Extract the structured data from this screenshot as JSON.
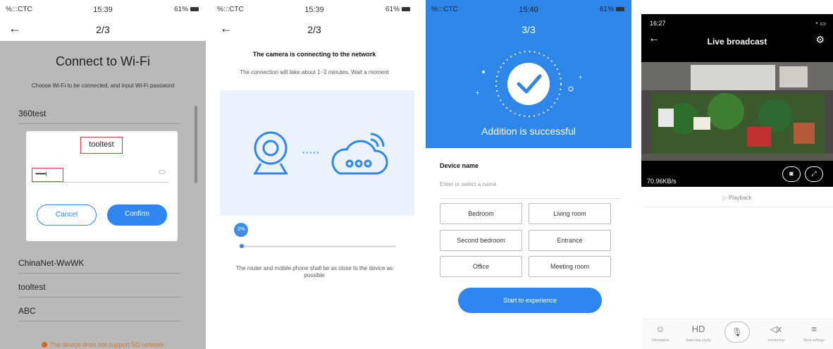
{
  "colors": {
    "accent": "#2f86ee",
    "highlight": "#e03a3a",
    "warning": "#d8641a"
  },
  "screen1": {
    "status": {
      "carrier": "%:::CTC",
      "time": "15:39",
      "battery": "61%"
    },
    "step": "2/3",
    "title": "Connect to Wi-Fi",
    "subtitle": "Choose Wi-Fi to be connected, and input Wi-Fi password",
    "wifi": [
      "360test",
      "ChinaNet-WwWK",
      "tooltest",
      "ABC"
    ],
    "dialog": {
      "network": "tooltest",
      "password": "••••••••|",
      "cancel": "Cancel",
      "confirm": "Confirm"
    },
    "warning": "The device does not support 5G network"
  },
  "screen2": {
    "status": {
      "carrier": "%:::CTC",
      "time": "15:39",
      "battery": "61%"
    },
    "step": "2/3",
    "title": "The camera is connecting to the network",
    "subtitle": "The connection will take about 1~2 minutes. Wait a moment",
    "dots": "·····",
    "progress_label": "2%",
    "progress": 0.02,
    "note": "The router and mobile phone shall be as close to the device as possible"
  },
  "screen3": {
    "status": {
      "carrier": "%:::CTC",
      "time": "15:40",
      "battery": "61%"
    },
    "step": "3/3",
    "success": "Addition is successful",
    "device_label": "Device name",
    "placeholder": "Enter or select a name",
    "rooms": [
      "Bedroom",
      "Living room",
      "Second bedroom",
      "Entrance",
      "Office",
      "Meeting room"
    ],
    "start": "Start to experience"
  },
  "screen4": {
    "status": {
      "time": "16:27"
    },
    "title": "Live broadcast",
    "speed": "70.96KB/s",
    "playback": "Playback",
    "bottom": [
      {
        "icon": "chat-icon",
        "glyph": "☺",
        "label": "Information"
      },
      {
        "icon": "hd-icon",
        "glyph": "HD",
        "label": "Switching clarity"
      },
      {
        "icon": "mic-icon",
        "glyph": "🎙",
        "label": "Talkback"
      },
      {
        "icon": "speaker-icon",
        "glyph": "◁x",
        "label": "monitoring"
      },
      {
        "icon": "menu-icon",
        "glyph": "≡",
        "label": "More settings"
      }
    ]
  }
}
